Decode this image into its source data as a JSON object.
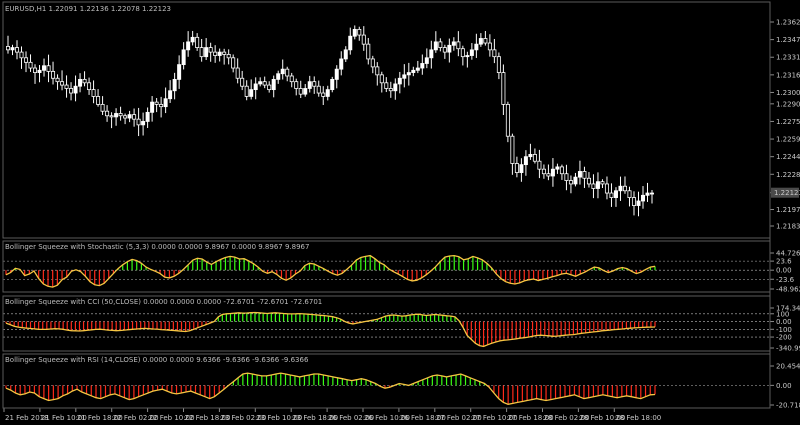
{
  "window": {
    "title": "EURUSD,H1  1.22091 1.22136 1.22078 1.22123"
  },
  "colors": {
    "background": "#000000",
    "candle_bull": "#ffffff",
    "candle_bear": "#000000",
    "positive_hist": "#39ff14",
    "negative_hist": "#ff2a1a",
    "signal_line": "#f5c542",
    "grid": "#3a3a3a",
    "price_box": "#4a4a4a"
  },
  "chart_data": [
    {
      "type": "candlestick",
      "title": "EURUSD,H1  1.22091 1.22136 1.22078 1.22123",
      "y_ticks": [
        "1.23625",
        "1.23470",
        "1.23315",
        "1.23160",
        "1.23005",
        "1.22905",
        "1.22750",
        "1.22595",
        "1.22440",
        "1.22285",
        "1.22123",
        "1.21975",
        "1.21830"
      ],
      "y_tick_values": [
        1.23625,
        1.2347,
        1.23315,
        1.2316,
        1.23005,
        1.22905,
        1.2275,
        1.22595,
        1.2244,
        1.22285,
        1.22123,
        1.21975,
        1.2183
      ],
      "current_price": "1.22123",
      "current_price_value": 1.22123,
      "ylim": [
        1.2183,
        1.23625
      ],
      "close": [
        1.2338,
        1.234,
        1.2336,
        1.2331,
        1.2327,
        1.2322,
        1.2318,
        1.232,
        1.2324,
        1.2319,
        1.2313,
        1.231,
        1.2307,
        1.2304,
        1.23,
        1.2306,
        1.2312,
        1.2309,
        1.2303,
        1.2297,
        1.229,
        1.2284,
        1.228,
        1.2279,
        1.2282,
        1.228,
        1.2278,
        1.2281,
        1.2277,
        1.2272,
        1.2275,
        1.2283,
        1.2292,
        1.229,
        1.2288,
        1.2295,
        1.2302,
        1.2312,
        1.2325,
        1.2338,
        1.2345,
        1.2349,
        1.234,
        1.2332,
        1.234,
        1.2336,
        1.2333,
        1.2336,
        1.2334,
        1.2331,
        1.2322,
        1.2313,
        1.2306,
        1.2297,
        1.2303,
        1.2308,
        1.231,
        1.2307,
        1.2303,
        1.2312,
        1.2317,
        1.2321,
        1.2315,
        1.231,
        1.2304,
        1.2299,
        1.2304,
        1.231,
        1.2306,
        1.23,
        1.2297,
        1.2303,
        1.2312,
        1.2321,
        1.233,
        1.2338,
        1.235,
        1.2356,
        1.2351,
        1.2343,
        1.233,
        1.2323,
        1.2316,
        1.2309,
        1.2304,
        1.2302,
        1.2308,
        1.2313,
        1.2316,
        1.2318,
        1.232,
        1.2322,
        1.2326,
        1.2331,
        1.2338,
        1.2345,
        1.234,
        1.2336,
        1.2342,
        1.2345,
        1.2339,
        1.2332,
        1.2333,
        1.2338,
        1.2343,
        1.2348,
        1.2344,
        1.2338,
        1.2332,
        1.2318,
        1.229,
        1.2262,
        1.2238,
        1.223,
        1.2237,
        1.2244,
        1.2246,
        1.224,
        1.2233,
        1.2229,
        1.2227,
        1.2233,
        1.2235,
        1.2229,
        1.2223,
        1.222,
        1.2226,
        1.2231,
        1.2225,
        1.222,
        1.2216,
        1.2222,
        1.222,
        1.2212,
        1.2208,
        1.2214,
        1.2218,
        1.2214,
        1.2208,
        1.2201,
        1.2205,
        1.221,
        1.2212,
        1.2212
      ]
    },
    {
      "type": "bar",
      "title": "Bollinger Squeeze with Stochastic (5,3,3) 0.0000 0.0000 9.8967 0.0000 9.8967 9.8967",
      "y_ticks": [
        "44.7267",
        "23.6",
        "0.00",
        "-23.6",
        "-48.9625"
      ],
      "ylim": [
        -48.9625,
        44.7267
      ],
      "values": [
        -12,
        -6,
        5,
        2,
        -14,
        -10,
        -2,
        -22,
        -36,
        -42,
        -44,
        -39,
        -25,
        -18,
        -3,
        1,
        -4,
        -16,
        -30,
        -38,
        -40,
        -34,
        -22,
        -9,
        4,
        14,
        22,
        28,
        25,
        18,
        8,
        2,
        -3,
        -9,
        -18,
        -20,
        -16,
        -8,
        2,
        14,
        26,
        31,
        29,
        21,
        15,
        22,
        28,
        33,
        36,
        34,
        29,
        30,
        24,
        17,
        8,
        -3,
        -8,
        -4,
        -11,
        -21,
        -26,
        -20,
        -10,
        -2,
        12,
        18,
        16,
        10,
        4,
        -3,
        -9,
        -13,
        -8,
        2,
        13,
        26,
        33,
        36,
        38,
        30,
        20,
        14,
        3,
        -4,
        -10,
        -17,
        -24,
        -28,
        -26,
        -20,
        -12,
        -2,
        9,
        22,
        34,
        37,
        38,
        35,
        27,
        30,
        36,
        32,
        27,
        18,
        6,
        -10,
        -22,
        -30,
        -34,
        -36,
        -33,
        -28,
        -25,
        -23,
        -27,
        -24,
        -21,
        -17,
        -14,
        -10,
        -8,
        -12,
        -16,
        -10,
        -5,
        2,
        8,
        6,
        -1,
        -6,
        -2,
        4,
        7,
        4,
        -3,
        -9,
        -5,
        2,
        8,
        10
      ]
    },
    {
      "type": "bar",
      "title": "Bollinger Squeeze with CCI (50,CLOSE) 0.0000 0.0000 0.0000 -72.6701 -72.6701 -72.6701",
      "y_ticks": [
        "174.3431",
        "100",
        "0.00",
        "-100",
        "-200",
        "-340.9951"
      ],
      "ylim": [
        -340.9951,
        174.3431
      ],
      "values": [
        -20,
        -40,
        -60,
        -72,
        -80,
        -85,
        -90,
        -95,
        -100,
        -102,
        -100,
        -96,
        -92,
        -95,
        -100,
        -110,
        -118,
        -120,
        -122,
        -118,
        -112,
        -106,
        -102,
        -99,
        -104,
        -110,
        -113,
        -118,
        -115,
        -110,
        -105,
        -100,
        -96,
        -92,
        -88,
        -92,
        -96,
        -98,
        -104,
        -108,
        -112,
        -115,
        -120,
        -124,
        -128,
        -120,
        -100,
        -80,
        -60,
        -40,
        -20,
        0,
        60,
        90,
        100,
        104,
        108,
        112,
        108,
        110,
        114,
        116,
        112,
        108,
        104,
        110,
        112,
        108,
        104,
        100,
        98,
        100,
        102,
        98,
        94,
        90,
        86,
        80,
        76,
        70,
        62,
        50,
        30,
        0,
        -20,
        -30,
        -20,
        -10,
        0,
        10,
        20,
        30,
        50,
        70,
        80,
        84,
        78,
        70,
        74,
        84,
        90,
        94,
        86,
        78,
        84,
        90,
        86,
        80,
        74,
        70,
        60,
        10,
        -80,
        -180,
        -230,
        -280,
        -310,
        -320,
        -300,
        -280,
        -264,
        -250,
        -240,
        -236,
        -230,
        -222,
        -214,
        -208,
        -200,
        -190,
        -180,
        -176,
        -180,
        -184,
        -190,
        -188,
        -182,
        -176,
        -172,
        -168,
        -160,
        -152,
        -146,
        -140,
        -134,
        -128,
        -120,
        -116,
        -110,
        -104,
        -100,
        -96,
        -90,
        -86,
        -82,
        -78,
        -75,
        -73,
        -72,
        -71
      ]
    },
    {
      "type": "bar",
      "title": "Bollinger Squeeze with RSI (14,CLOSE) 0.0000 0.0000 9.6366 -9.6366 -9.6366 -9.6366",
      "y_ticks": [
        "20.4548",
        "0.00",
        "-20.7183"
      ],
      "ylim": [
        -20.7183,
        20.4548
      ],
      "values": [
        -3,
        -5,
        -8,
        -10,
        -9,
        -7,
        -8,
        -12,
        -14,
        -16,
        -15,
        -14,
        -11,
        -9,
        -6,
        -4,
        -7,
        -9,
        -11,
        -13,
        -14,
        -12,
        -10,
        -9,
        -11,
        -13,
        -15,
        -14,
        -12,
        -10,
        -8,
        -6,
        -5,
        -4,
        -6,
        -8,
        -9,
        -8,
        -7,
        -6,
        -8,
        -10,
        -12,
        -14,
        -12,
        -8,
        -4,
        0,
        4,
        8,
        12,
        13,
        12,
        11,
        10,
        10,
        11,
        12,
        13,
        12,
        11,
        10,
        9,
        10,
        11,
        12,
        12,
        11,
        10,
        9,
        8,
        7,
        6,
        5,
        6,
        7,
        6,
        4,
        2,
        -1,
        -3,
        -2,
        0,
        2,
        1,
        0,
        2,
        4,
        6,
        8,
        10,
        11,
        10,
        9,
        10,
        11,
        12,
        10,
        8,
        6,
        4,
        2,
        -2,
        -8,
        -14,
        -18,
        -20,
        -19,
        -18,
        -17,
        -16,
        -15,
        -14,
        -15,
        -16,
        -15,
        -14,
        -13,
        -12,
        -11,
        -10,
        -12,
        -14,
        -13,
        -12,
        -11,
        -10,
        -11,
        -12,
        -13,
        -12,
        -11,
        -12,
        -13,
        -14,
        -12,
        -10,
        -9.6
      ]
    }
  ],
  "x_axis": {
    "labels": [
      "21 Feb 2018",
      "21 Feb 10:00",
      "21 Feb 18:00",
      "22 Feb 02:00",
      "22 Feb 10:00",
      "22 Feb 18:00",
      "23 Feb 02:00",
      "23 Feb 10:00",
      "23 Feb 18:00",
      "26 Feb 02:00",
      "26 Feb 10:00",
      "26 Feb 18:00",
      "27 Feb 02:00",
      "27 Feb 10:00",
      "27 Feb 18:00",
      "28 Feb 02:00",
      "28 Feb 10:00",
      "28 Feb 18:00"
    ]
  }
}
